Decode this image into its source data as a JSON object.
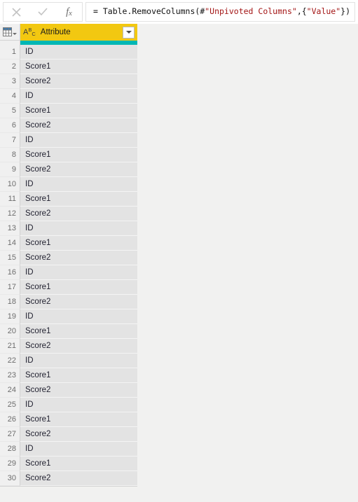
{
  "formula_bar": {
    "cancel_icon": "close-icon",
    "accept_icon": "check-icon",
    "fx_label": "f",
    "fx_sub": "x",
    "formula_prefix": "= Table.RemoveColumns(#",
    "formula_arg1": "\"Unpivoted Columns\"",
    "formula_mid": ",{",
    "formula_arg2": "\"Value\"",
    "formula_suffix": "})",
    "formula_full": "= Table.RemoveColumns(#\"Unpivoted Columns\",{\"Value\"})"
  },
  "colors": {
    "header_gold": "#f2c811",
    "quality_teal": "#00b7b4",
    "cell_gray": "#e3e3e3",
    "gutter_gray": "#f0f0f0",
    "canvas_gray": "#f1f1f0",
    "string_literal": "#a31515"
  },
  "table": {
    "column": {
      "name": "Attribute",
      "type_icon": "abc-text-type-icon",
      "type_icon_letters": {
        "a": "A",
        "b": "B",
        "c": "C"
      },
      "filter_icon": "chevron-down-icon"
    },
    "corner_icon": "table-grid-icon",
    "rows": [
      {
        "num": "1",
        "value": "ID"
      },
      {
        "num": "2",
        "value": "Score1"
      },
      {
        "num": "3",
        "value": "Score2"
      },
      {
        "num": "4",
        "value": "ID"
      },
      {
        "num": "5",
        "value": "Score1"
      },
      {
        "num": "6",
        "value": "Score2"
      },
      {
        "num": "7",
        "value": "ID"
      },
      {
        "num": "8",
        "value": "Score1"
      },
      {
        "num": "9",
        "value": "Score2"
      },
      {
        "num": "10",
        "value": "ID"
      },
      {
        "num": "11",
        "value": "Score1"
      },
      {
        "num": "12",
        "value": "Score2"
      },
      {
        "num": "13",
        "value": "ID"
      },
      {
        "num": "14",
        "value": "Score1"
      },
      {
        "num": "15",
        "value": "Score2"
      },
      {
        "num": "16",
        "value": "ID"
      },
      {
        "num": "17",
        "value": "Score1"
      },
      {
        "num": "18",
        "value": "Score2"
      },
      {
        "num": "19",
        "value": "ID"
      },
      {
        "num": "20",
        "value": "Score1"
      },
      {
        "num": "21",
        "value": "Score2"
      },
      {
        "num": "22",
        "value": "ID"
      },
      {
        "num": "23",
        "value": "Score1"
      },
      {
        "num": "24",
        "value": "Score2"
      },
      {
        "num": "25",
        "value": "ID"
      },
      {
        "num": "26",
        "value": "Score1"
      },
      {
        "num": "27",
        "value": "Score2"
      },
      {
        "num": "28",
        "value": "ID"
      },
      {
        "num": "29",
        "value": "Score1"
      },
      {
        "num": "30",
        "value": "Score2"
      }
    ]
  }
}
